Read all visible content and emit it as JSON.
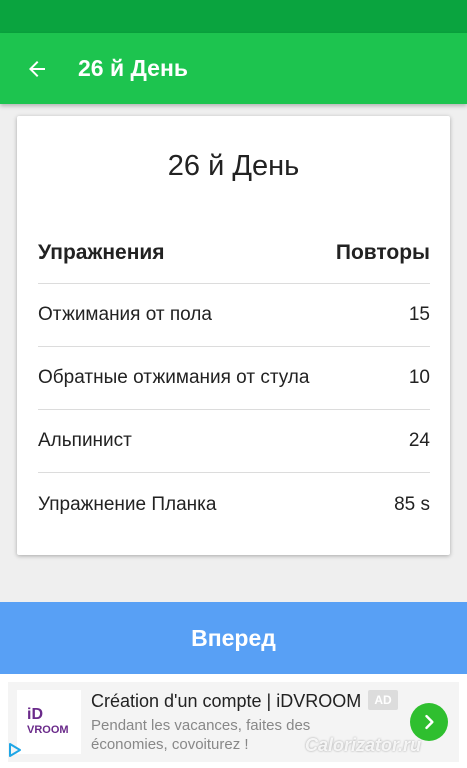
{
  "app_bar": {
    "title": "26 й День",
    "back_icon": "arrow-left-icon"
  },
  "card": {
    "title": "26 й День",
    "header": {
      "exercise": "Упражнения",
      "reps": "Повторы"
    },
    "rows": [
      {
        "exercise": "Отжимания от пола",
        "reps": "15"
      },
      {
        "exercise": "Обратные отжимания от стула",
        "reps": "10"
      },
      {
        "exercise": "Альпинист",
        "reps": "24"
      },
      {
        "exercise": "Упражнение Планка",
        "reps": "85 s"
      }
    ]
  },
  "next_button": {
    "label": "Вперед"
  },
  "ad": {
    "logo_id": "iD",
    "logo_text": "VROOM",
    "headline": "Création d'un compte | iDVROOM",
    "badge": "AD",
    "description": "Pendant les vacances, faites des économies, covoiturez !",
    "arrow_icon": "chevron-right-icon",
    "adchoices_icon": "adchoices-icon"
  },
  "watermark": "Calorizator.ru",
  "colors": {
    "status_bar": "#0aa43f",
    "app_bar": "#1dc44f",
    "next_button": "#58a0f5",
    "ad_arrow": "#2fbf2f"
  }
}
